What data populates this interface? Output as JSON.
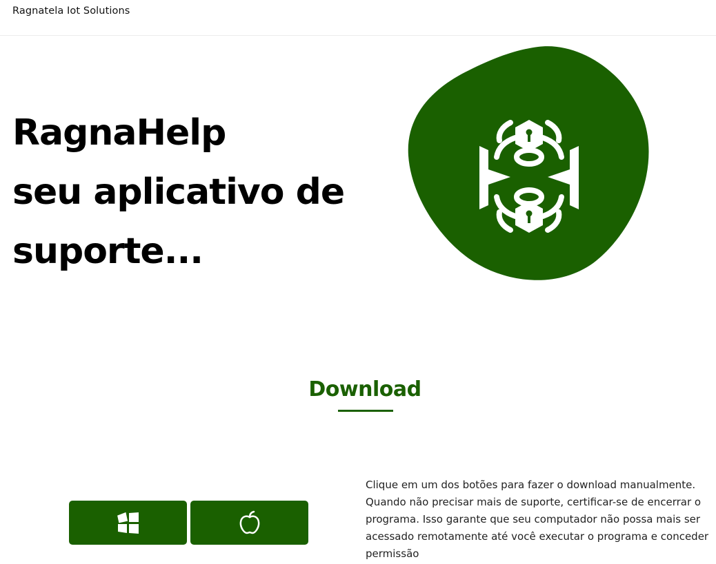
{
  "navbar": {
    "brand": "Ragnatela Iot Solutions"
  },
  "hero": {
    "title_lines": [
      "RagnaHelp",
      "seu aplicativo de",
      "suporte..."
    ],
    "blob_color": "#1a6000",
    "illustration_icon": "security-bug-lock-icon"
  },
  "download": {
    "title": "Download",
    "accent_color": "#1a6000",
    "buttons": [
      {
        "icon": "windows-icon"
      },
      {
        "icon": "apple-icon"
      }
    ],
    "description": "Clique em um dos botões para fazer o download manualmente. Quando não precisar mais de suporte, certificar-se de encerrar o programa. Isso garante que seu computador não possa mais ser acessado remotamente até você executar o programa e conceder permissão"
  }
}
